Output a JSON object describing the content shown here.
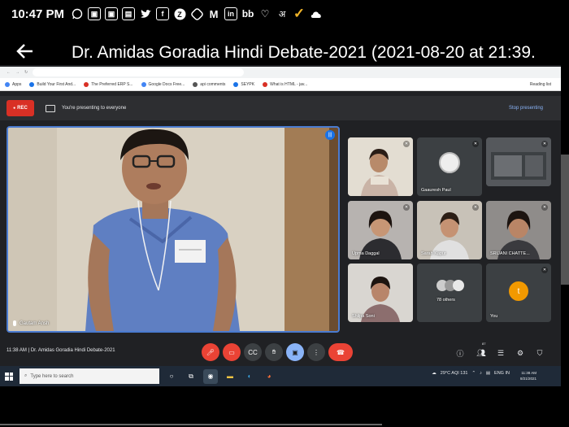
{
  "status_bar": {
    "time": "10:47 PM",
    "icons": [
      "whatsapp-icon",
      "image-icon",
      "image-icon",
      "flipboard-icon",
      "twitter-icon",
      "facebook-icon",
      "zomato-icon",
      "squares-icon",
      "myntra-icon",
      "linkedin-icon",
      "bb-icon",
      "heart-pulse-icon",
      "language-icon",
      "checkmark-icon",
      "cloud-icon"
    ]
  },
  "player": {
    "title": "Dr. Amidas Goradia Hindi Debate-2021 (2021-08-20 at 21:39."
  },
  "meet": {
    "rec_label": "REC",
    "presenting_text": "You're presenting to everyone",
    "stop_presenting": "Stop presenting",
    "main_speaker": "Gautam Ansh",
    "meeting_time": "11:38 AM",
    "meeting_title": "Dr. Amidas Goradia Hindi Debate-2021",
    "people_count": "87",
    "participants": [
      {
        "name": ""
      },
      {
        "name": "Gaauresh Paul"
      },
      {
        "name": ""
      },
      {
        "name": "Upma Daggal"
      },
      {
        "name": "Sarah Kapur"
      },
      {
        "name": "SRIJANI CHATTE..."
      },
      {
        "name": "Shilpa Soni"
      },
      {
        "name": "78 others"
      },
      {
        "name": "You"
      }
    ]
  },
  "browser": {
    "bookmarks": [
      "Apps",
      "Build Your First And...",
      "The Preferred ERP S...",
      "Google Docs Free...",
      "api comments",
      "SEYPK",
      "What is HTML - jav..."
    ],
    "reading_list": "Reading list"
  },
  "taskbar": {
    "search_placeholder": "Type here to search",
    "weather": "29°C  AQI 131",
    "lang": "ENG IN",
    "clock_time": "11:38 AM",
    "clock_date": "8/21/2021"
  }
}
